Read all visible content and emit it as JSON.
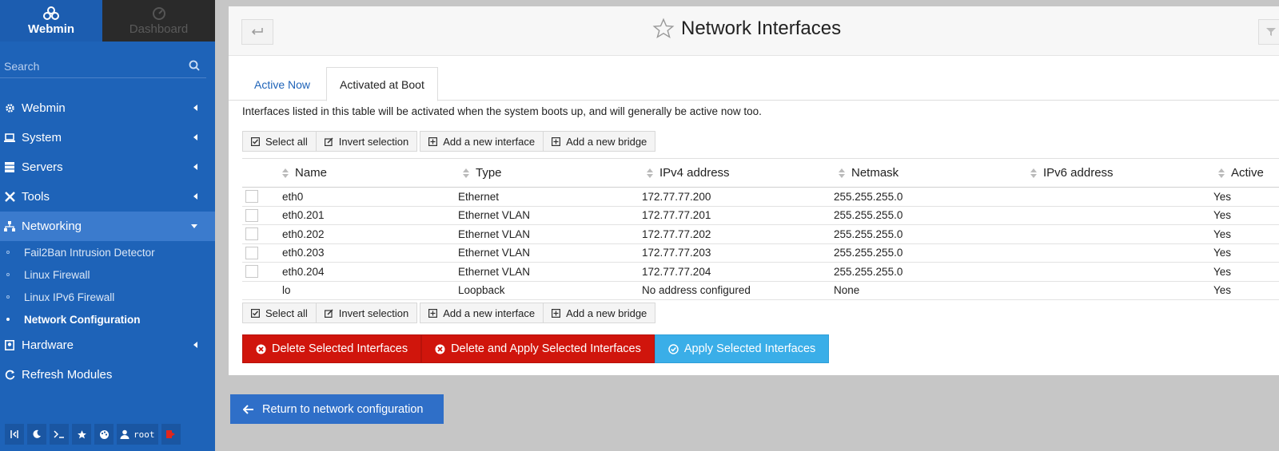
{
  "sidebar": {
    "tabs": {
      "webmin": "Webmin",
      "dashboard": "Dashboard"
    },
    "search_placeholder": "Search",
    "menu": [
      {
        "label": "Webmin",
        "icon": "gear-icon"
      },
      {
        "label": "System",
        "icon": "laptop-icon"
      },
      {
        "label": "Servers",
        "icon": "server-icon"
      },
      {
        "label": "Tools",
        "icon": "wrench-icon"
      },
      {
        "label": "Networking",
        "icon": "network-icon"
      }
    ],
    "networking_sub": [
      "Fail2Ban Intrusion Detector",
      "Linux Firewall",
      "Linux IPv6 Firewall",
      "Network Configuration"
    ],
    "menu_after": [
      {
        "label": "Hardware",
        "icon": "hdd-icon"
      },
      {
        "label": "Refresh Modules",
        "icon": "refresh-icon"
      }
    ],
    "user": "root"
  },
  "header": {
    "title": "Network Interfaces"
  },
  "tabs": {
    "active_now": "Active Now",
    "activated_at_boot": "Activated at Boot"
  },
  "description": "Interfaces listed in this table will be activated when the system boots up, and will generally be active now too.",
  "buttons": {
    "select_all": "Select all",
    "invert_selection": "Invert selection",
    "add_interface": "Add a new interface",
    "add_bridge": "Add a new bridge"
  },
  "table": {
    "columns": [
      "Name",
      "Type",
      "IPv4 address",
      "Netmask",
      "IPv6 address",
      "Active"
    ],
    "rows": [
      {
        "name": "eth0",
        "type": "Ethernet",
        "ipv4": "172.77.77.200",
        "netmask": "255.255.255.0",
        "ipv6": "",
        "active": "Yes"
      },
      {
        "name": "eth0.201",
        "type": "Ethernet VLAN",
        "ipv4": "172.77.77.201",
        "netmask": "255.255.255.0",
        "ipv6": "",
        "active": "Yes"
      },
      {
        "name": "eth0.202",
        "type": "Ethernet VLAN",
        "ipv4": "172.77.77.202",
        "netmask": "255.255.255.0",
        "ipv6": "",
        "active": "Yes"
      },
      {
        "name": "eth0.203",
        "type": "Ethernet VLAN",
        "ipv4": "172.77.77.203",
        "netmask": "255.255.255.0",
        "ipv6": "",
        "active": "Yes"
      },
      {
        "name": "eth0.204",
        "type": "Ethernet VLAN",
        "ipv4": "172.77.77.204",
        "netmask": "255.255.255.0",
        "ipv6": "",
        "active": "Yes"
      },
      {
        "name": "lo",
        "type": "Loopback",
        "ipv4": "No address configured",
        "netmask": "None",
        "ipv6": "",
        "active": "Yes"
      }
    ]
  },
  "actions": {
    "delete": "Delete Selected Interfaces",
    "delete_apply": "Delete and Apply Selected Interfaces",
    "apply": "Apply Selected Interfaces"
  },
  "return_label": "Return to network configuration",
  "colors": {
    "sidebar": "#1e63b8",
    "danger": "#d0150c",
    "info": "#3aaee8",
    "primary": "#2f6fc8"
  }
}
